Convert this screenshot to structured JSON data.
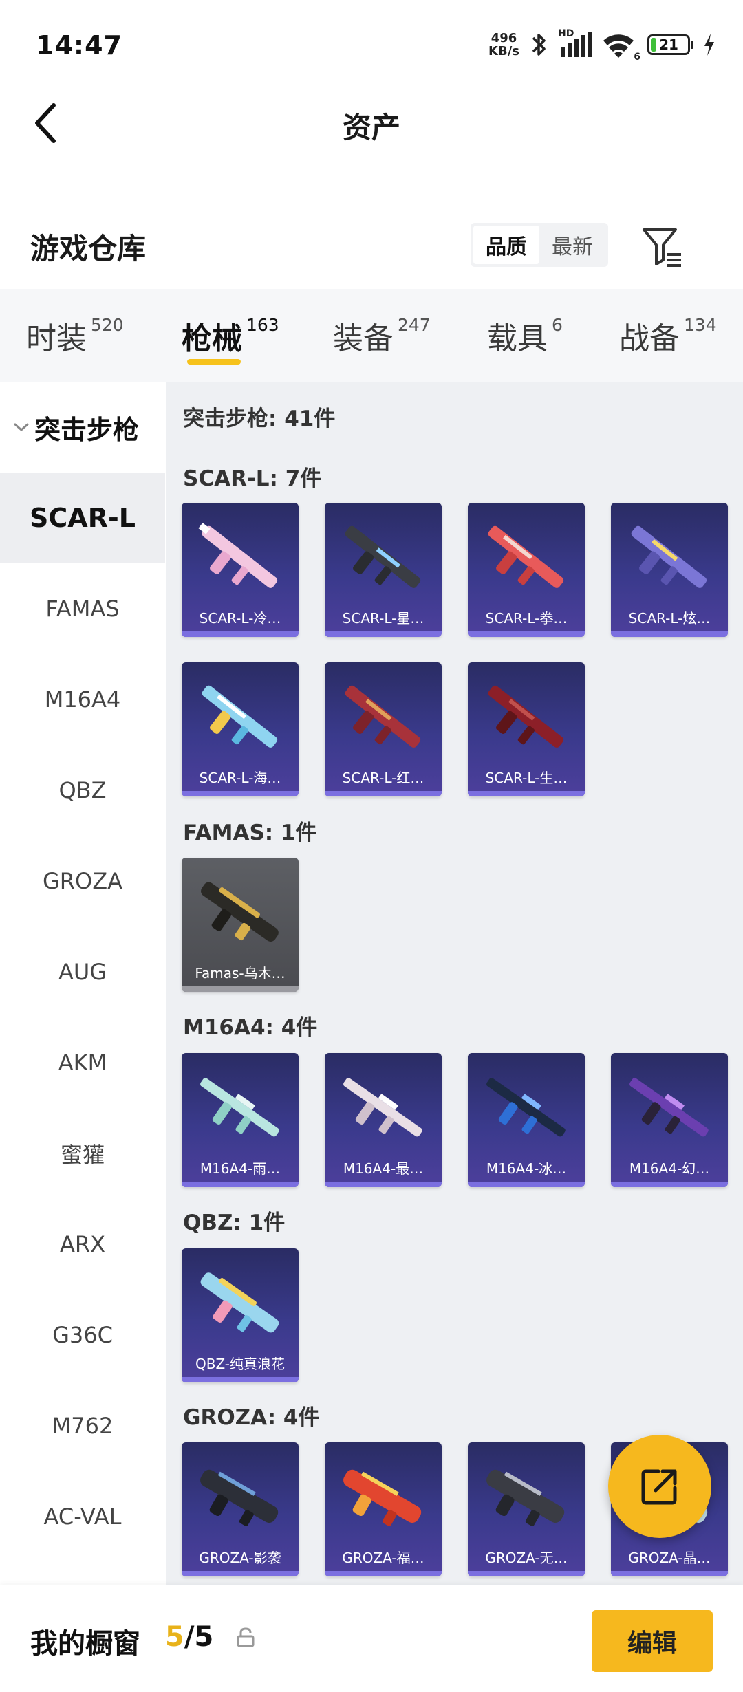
{
  "status": {
    "time": "14:47",
    "net_speed_value": "496",
    "net_speed_unit": "KB/s",
    "signal_label": "HD",
    "wifi_label": "6",
    "battery": "21",
    "battery_level": 0.21
  },
  "header": {
    "title": "资产"
  },
  "warehouse": {
    "title": "游戏仓库",
    "sort_options": [
      "品质",
      "最新"
    ],
    "sort_active": "品质"
  },
  "tabs": [
    {
      "label": "时装",
      "count": "520"
    },
    {
      "label": "枪械",
      "count": "163",
      "active": true
    },
    {
      "label": "装备",
      "count": "247"
    },
    {
      "label": "载具",
      "count": "6"
    },
    {
      "label": "战备",
      "count": "134"
    }
  ],
  "sidebar": {
    "group": "突击步枪",
    "items": [
      "SCAR-L",
      "FAMAS",
      "M16A4",
      "QBZ",
      "GROZA",
      "AUG",
      "AKM",
      "蜜獾",
      "ARX",
      "G36C",
      "M762",
      "AC-VAL"
    ],
    "active": "SCAR-L"
  },
  "content": {
    "summary": "突击步枪: 41件",
    "groups": [
      {
        "title": "SCAR-L: 7件",
        "items": [
          "SCAR-L-冷…",
          "SCAR-L-星…",
          "SCAR-L-拳…",
          "SCAR-L-炫…",
          "SCAR-L-海…",
          "SCAR-L-红…",
          "SCAR-L-生…"
        ]
      },
      {
        "title": "FAMAS: 1件",
        "items": [
          "Famas-乌木…"
        ]
      },
      {
        "title": "M16A4: 4件",
        "items": [
          "M16A4-雨…",
          "M16A4-最…",
          "M16A4-冰…",
          "M16A4-幻…"
        ]
      },
      {
        "title": "QBZ: 1件",
        "items": [
          "QBZ-纯真浪花"
        ]
      },
      {
        "title": "GROZA: 4件",
        "items": [
          "GROZA-影袭",
          "GROZA-福…",
          "GROZA-无…",
          "GROZA-晶…"
        ]
      }
    ]
  },
  "bottom": {
    "showcase_label": "我的橱窗",
    "showcase_current": "5",
    "showcase_total": "/5",
    "edit_label": "编辑"
  },
  "colors": {
    "accent": "#f6b81e",
    "card_purple": "#3a3a8c",
    "card_grey": "#4a4b50"
  }
}
